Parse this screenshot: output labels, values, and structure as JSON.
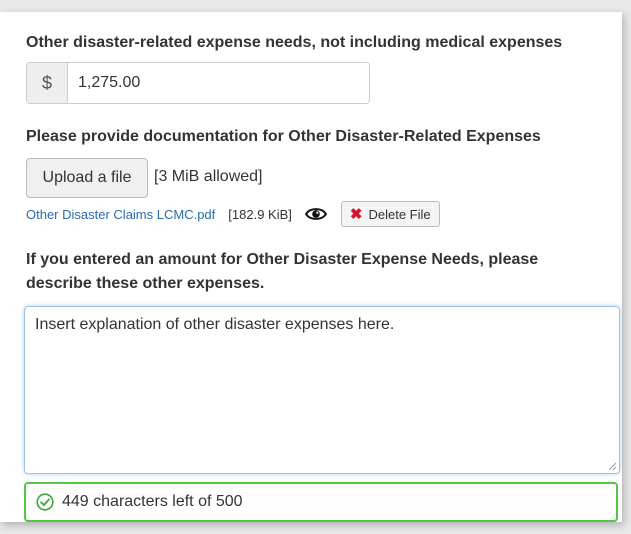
{
  "expense": {
    "label": "Other disaster-related expense needs, not including medical expenses",
    "currency_symbol": "$",
    "value": "1,275.00"
  },
  "documentation": {
    "label": "Please provide documentation for Other Disaster-Related Expenses",
    "upload_label": "Upload a file",
    "allowed_text": "[3 MiB allowed]",
    "file_name": "Other Disaster Claims LCMC.pdf",
    "file_size": "[182.9 KiB]",
    "delete_label": "Delete File"
  },
  "explanation": {
    "label_line1": "If you entered an amount for Other Disaster Expense Needs, please",
    "label_line2": "describe these other expenses.",
    "value": "Insert explanation of other disaster expenses here."
  },
  "counter": {
    "text": "449 characters left of 500"
  },
  "colors": {
    "link": "#2a6ab2",
    "delete_icon": "#d9162b",
    "success_border": "#54c645",
    "focus_border": "#9fc3ea"
  },
  "icons": {
    "view": "eye-icon",
    "delete": "x-icon",
    "counter": "check-circle-icon"
  }
}
